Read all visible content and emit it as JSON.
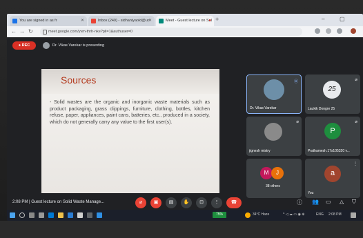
{
  "browser": {
    "tabs": [
      {
        "title": "You are signed in as fr",
        "favicon_color": "#1a73e8",
        "active": false
      },
      {
        "title": "Inbox (240) - sidhaniyaold@uc",
        "favicon_color": "#ea4335",
        "active": false
      },
      {
        "title": "Meet - Guest lecture on Sol",
        "favicon_color": "#00897b",
        "active": true
      }
    ],
    "new_tab": "+",
    "url": "meet.google.com/yvm-thrh-nke?pli=1&authuser=0"
  },
  "meet": {
    "rec_label": "REC",
    "presenting_label": "Dr. Vikas Varekar is presenting",
    "slide": {
      "title": "Sources",
      "body": "- Solid wastes are the organic and inorganic waste materials such as product packaging, grass clippings, furniture, clothing, bottles, kitchen refuse, paper, appliances, paint cans, batteries, etc., produced in a society, which do not generally carry any value to the first user(s)."
    },
    "participants": [
      {
        "name": "Dr. Vikas Varekar",
        "initial": "",
        "color": "#6d8fa8",
        "speaking": true
      },
      {
        "name": "Laukik Dongre 25",
        "initial": "25",
        "color": "#e8eaed",
        "speaking": false
      },
      {
        "name": "jignesh mistry",
        "initial": "",
        "color": "#8a8a8a",
        "speaking": false
      },
      {
        "name": "Prathamesh.17s105320 v...",
        "initial": "P",
        "color": "#1e8e3e",
        "speaking": false
      },
      {
        "name": "38 others",
        "initials": [
          "M",
          "J"
        ],
        "colors": [
          "#c2185b",
          "#e8710a"
        ],
        "speaking": false
      },
      {
        "name": "You",
        "initial": "a",
        "color": "#a1452e",
        "speaking": false
      }
    ],
    "meeting_time": "2:08 PM",
    "meeting_title": "Guest lecture on Solid Waste Manage...",
    "controls": [
      "mic-off",
      "camera-off",
      "captions",
      "raise-hand",
      "present",
      "more",
      "hang-up"
    ],
    "side_controls": [
      "info",
      "people",
      "chat",
      "activities",
      "shield"
    ]
  },
  "taskbar": {
    "battery_label": "75%",
    "weather": "34°C Haze",
    "lang": "ENG",
    "clock": "2:08 PM"
  }
}
